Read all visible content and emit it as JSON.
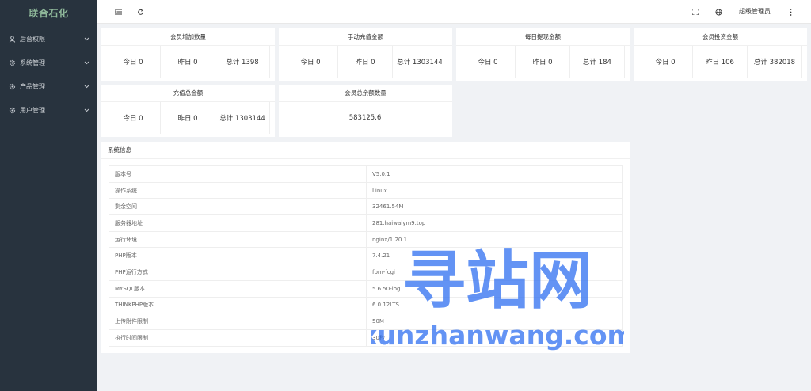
{
  "sidebar": {
    "logo": "联合石化",
    "items": [
      {
        "label": "后台权限",
        "icon": "user-icon"
      },
      {
        "label": "系统管理",
        "icon": "gear-icon"
      },
      {
        "label": "产品管理",
        "icon": "gear-icon"
      },
      {
        "label": "用户管理",
        "icon": "gear-icon"
      }
    ]
  },
  "header": {
    "menu_icon": "hamburger-icon",
    "refresh_icon": "refresh-icon",
    "fullscreen_icon": "fullscreen-icon",
    "language_icon": "globe-icon",
    "user_label": "超级管理员",
    "more_icon": "more-vertical-icon"
  },
  "cards": [
    {
      "title": "会员增加数量",
      "today": "今日 0",
      "yesterday": "昨日 0",
      "total": "总计 1398"
    },
    {
      "title": "手动充值金额",
      "today": "今日 0",
      "yesterday": "昨日 0",
      "total": "总计 1303144"
    },
    {
      "title": "每日提现金额",
      "today": "今日 0",
      "yesterday": "昨日 0",
      "total": "总计 184"
    },
    {
      "title": "会员投资金额",
      "today": "今日 0",
      "yesterday": "昨日 106",
      "total": "总计 382018"
    },
    {
      "title": "充值总金额",
      "today": "今日 0",
      "yesterday": "昨日 0",
      "total": "总计 1303144"
    },
    {
      "title": "会员总余额数量",
      "value": "583125.6"
    }
  ],
  "system_info": {
    "title": "系统信息",
    "rows": [
      {
        "key": "版本号",
        "value": "V5.0.1"
      },
      {
        "key": "操作系统",
        "value": "Linux"
      },
      {
        "key": "剩余空间",
        "value": "32461.54M"
      },
      {
        "key": "服务器地址",
        "value": "281.haiwaiym9.top"
      },
      {
        "key": "运行环境",
        "value": "nginx/1.20.1"
      },
      {
        "key": "PHP版本",
        "value": "7.4.21"
      },
      {
        "key": "PHP运行方式",
        "value": "fpm-fcgi"
      },
      {
        "key": "MYSQL版本",
        "value": "5.6.50-log"
      },
      {
        "key": "THINKPHP版本",
        "value": "6.0.12LTS"
      },
      {
        "key": "上传附件限制",
        "value": "50M"
      },
      {
        "key": "执行时间限制",
        "value": "30秒"
      }
    ]
  },
  "watermark": {
    "cn": "寻站网",
    "en": "xunzhanwang.com",
    "color": "#2f6ff0"
  }
}
